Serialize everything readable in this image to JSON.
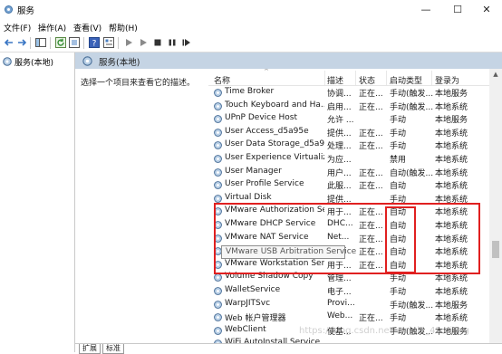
{
  "window": {
    "title": "服务",
    "minimize_glyph": "—",
    "maximize_glyph": "☐",
    "close_glyph": "✕"
  },
  "menu": [
    "文件(F)",
    "操作(A)",
    "查看(V)",
    "帮助(H)"
  ],
  "tree": {
    "root_label": "服务(本地)"
  },
  "panel": {
    "header_title": "服务(本地)",
    "description_prompt": "选择一个项目来查看它的描述。"
  },
  "columns": [
    "名称",
    "描述",
    "状态",
    "启动类型",
    "登录为"
  ],
  "services": [
    {
      "name": "Time Broker",
      "desc": "协调...",
      "state": "正在...",
      "start": "手动(触发...",
      "logon": "本地服务"
    },
    {
      "name": "Touch Keyboard and Ha...",
      "desc": "启用...",
      "state": "正在...",
      "start": "手动(触发...",
      "logon": "本地系统"
    },
    {
      "name": "UPnP Device Host",
      "desc": "允许 ...",
      "state": "",
      "start": "手动",
      "logon": "本地服务"
    },
    {
      "name": "User Access_d5a95e",
      "desc": "提供...",
      "state": "正在...",
      "start": "手动",
      "logon": "本地系统"
    },
    {
      "name": "User Data Storage_d5a95e",
      "desc": "处理...",
      "state": "正在...",
      "start": "手动",
      "logon": "本地系统"
    },
    {
      "name": "User Experience Virtualiz...",
      "desc": "为应...",
      "state": "",
      "start": "禁用",
      "logon": "本地系统"
    },
    {
      "name": "User Manager",
      "desc": "用户...",
      "state": "正在...",
      "start": "自动(触发...",
      "logon": "本地系统"
    },
    {
      "name": "User Profile Service",
      "desc": "此服...",
      "state": "正在...",
      "start": "自动",
      "logon": "本地系统"
    },
    {
      "name": "Virtual Disk",
      "desc": "提供...",
      "state": "",
      "start": "手动",
      "logon": "本地系统"
    },
    {
      "name": "VMware Authorization Se...",
      "desc": "用于...",
      "state": "正在...",
      "start": "自动",
      "logon": "本地系统"
    },
    {
      "name": "VMware DHCP Service",
      "desc": "DHC...",
      "state": "正在...",
      "start": "自动",
      "logon": "本地系统"
    },
    {
      "name": "VMware NAT Service",
      "desc": "Net...",
      "state": "正在...",
      "start": "自动",
      "logon": "本地系统"
    },
    {
      "name": "VMware USB Arbitration Service",
      "desc": "",
      "state": "正在...",
      "start": "自动",
      "logon": "本地系统"
    },
    {
      "name": "VMware Workstation Ser...",
      "desc": "用于...",
      "state": "正在...",
      "start": "自动",
      "logon": "本地系统"
    },
    {
      "name": "Volume Shadow Copy",
      "desc": "管理...",
      "state": "",
      "start": "手动",
      "logon": "本地系统"
    },
    {
      "name": "WalletService",
      "desc": "电子...",
      "state": "",
      "start": "手动",
      "logon": "本地系统"
    },
    {
      "name": "WarpJITSvc",
      "desc": "Provi...",
      "state": "",
      "start": "手动(触发...",
      "logon": "本地服务"
    },
    {
      "name": "Web 帐户管理器",
      "desc": "Web...",
      "state": "正在...",
      "start": "手动",
      "logon": "本地系统"
    },
    {
      "name": "WebClient",
      "desc": "使基...",
      "state": "",
      "start": "手动(触发...",
      "logon": "本地服务"
    },
    {
      "name": "WiFi AutoInstall Service",
      "desc": "",
      "state": "",
      "start": "",
      "logon": ""
    }
  ],
  "tooltip": "VMware USB Arbitration Service",
  "tabs": [
    "扩展",
    "标准"
  ],
  "watermark": "https://blog.csdn.net/weixin_45...iang"
}
